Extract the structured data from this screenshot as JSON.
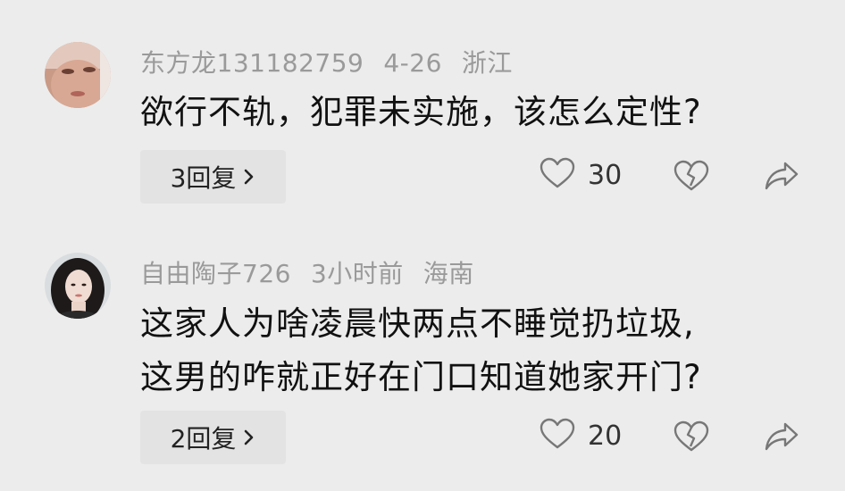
{
  "comments": [
    {
      "username": "东方龙131182759",
      "date": "4-26",
      "location": "浙江",
      "text_lines": [
        "欲行不轨，犯罪未实施，该怎么定性?"
      ],
      "reply_label": "3回复",
      "likes": "30",
      "avatar_icon": "user-avatar-photo"
    },
    {
      "username": "自由陶子726",
      "date": "3小时前",
      "location": "海南",
      "text_lines": [
        "这家人为啥凌晨快两点不睡觉扔垃圾,",
        "这男的咋就正好在门口知道她家开门?"
      ],
      "reply_label": "2回复",
      "likes": "20",
      "avatar_icon": "user-avatar-photo"
    }
  ],
  "icons": {
    "like": "heart-outline-icon",
    "dislike": "broken-heart-icon",
    "share": "share-arrow-icon",
    "reply_more": "chevron-right-icon"
  },
  "colors": {
    "background": "#ececec",
    "meta_text": "#9a9a9a",
    "body_text": "#111111",
    "icon": "#777777"
  }
}
